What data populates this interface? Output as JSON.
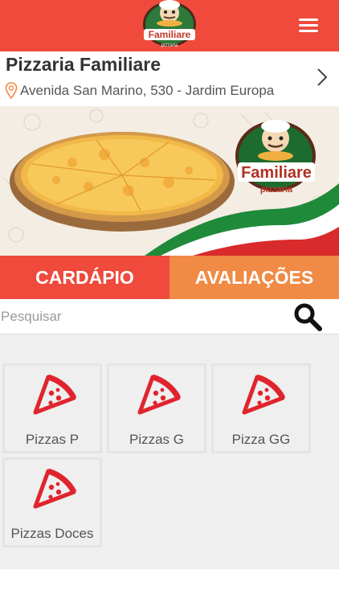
{
  "header": {
    "logo_text": "Familiare",
    "logo_subtext": "pizzaria",
    "menu_icon": "hamburger-menu-icon"
  },
  "store": {
    "name": "Pizzaria Familiare",
    "address": "Avenida San Marino, 530 - Jardim Europa",
    "location_icon": "map-pin-icon",
    "chevron_icon": "chevron-right-icon"
  },
  "banner": {
    "brand": "Familiare",
    "sub": "pizzaria"
  },
  "tabs": [
    {
      "label": "CARDÁPIO",
      "active": true
    },
    {
      "label": "AVALIAÇÕES",
      "active": false
    }
  ],
  "search": {
    "placeholder": "Pesquisar",
    "icon": "search-icon"
  },
  "categories": [
    {
      "label": "Pizzas P",
      "icon": "pizza-slice-icon"
    },
    {
      "label": "Pizzas G",
      "icon": "pizza-slice-icon"
    },
    {
      "label": "Pizza GG",
      "icon": "pizza-slice-icon"
    },
    {
      "label": "Pizzas Doces",
      "icon": "pizza-slice-icon"
    }
  ],
  "colors": {
    "primary": "#ef4a3c",
    "secondary": "#f08a45",
    "background": "#efefef"
  }
}
